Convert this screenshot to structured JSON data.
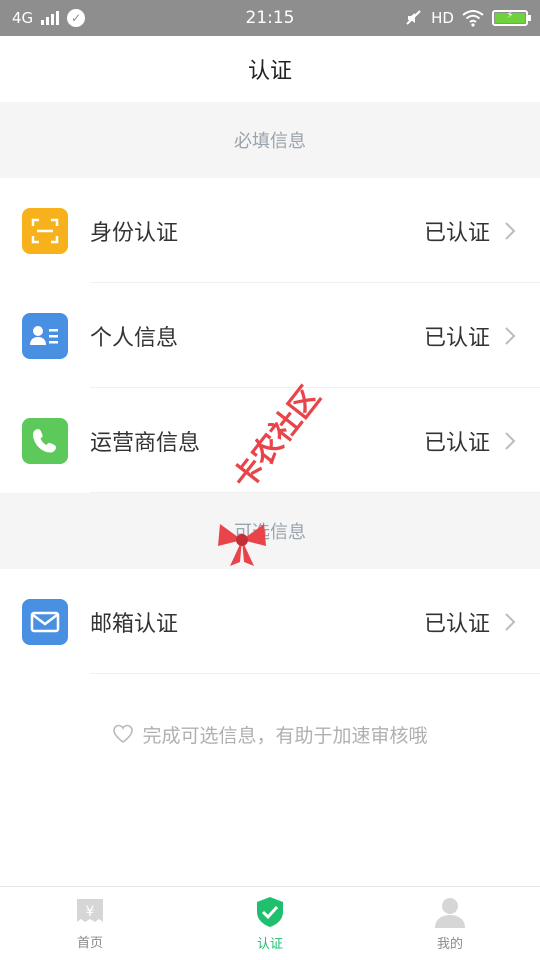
{
  "status_bar": {
    "network": "4G",
    "time": "21:15",
    "hd": "HD"
  },
  "header": {
    "title": "认证"
  },
  "sections": {
    "required_title": "必填信息",
    "optional_title": "可选信息"
  },
  "required_items": [
    {
      "label": "身份认证",
      "status": "已认证",
      "icon": "id-scan-icon",
      "color": "#f7b21b"
    },
    {
      "label": "个人信息",
      "status": "已认证",
      "icon": "contact-card-icon",
      "color": "#4a90e2"
    },
    {
      "label": "运营商信息",
      "status": "已认证",
      "icon": "phone-icon",
      "color": "#5cc95a"
    }
  ],
  "optional_items": [
    {
      "label": "邮箱认证",
      "status": "已认证",
      "icon": "mail-icon",
      "color": "#4a90e2"
    }
  ],
  "hint": {
    "text": "完成可选信息，有助于加速审核哦"
  },
  "tabs": [
    {
      "label": "首页",
      "icon": "home-yen-icon",
      "active": false
    },
    {
      "label": "认证",
      "icon": "shield-check-icon",
      "active": true
    },
    {
      "label": "我的",
      "icon": "user-icon",
      "active": false
    }
  ],
  "watermark": {
    "text": "卡农社区"
  },
  "colors": {
    "accent": "#1fbf6e",
    "status_bar": "#8e8e8e"
  }
}
